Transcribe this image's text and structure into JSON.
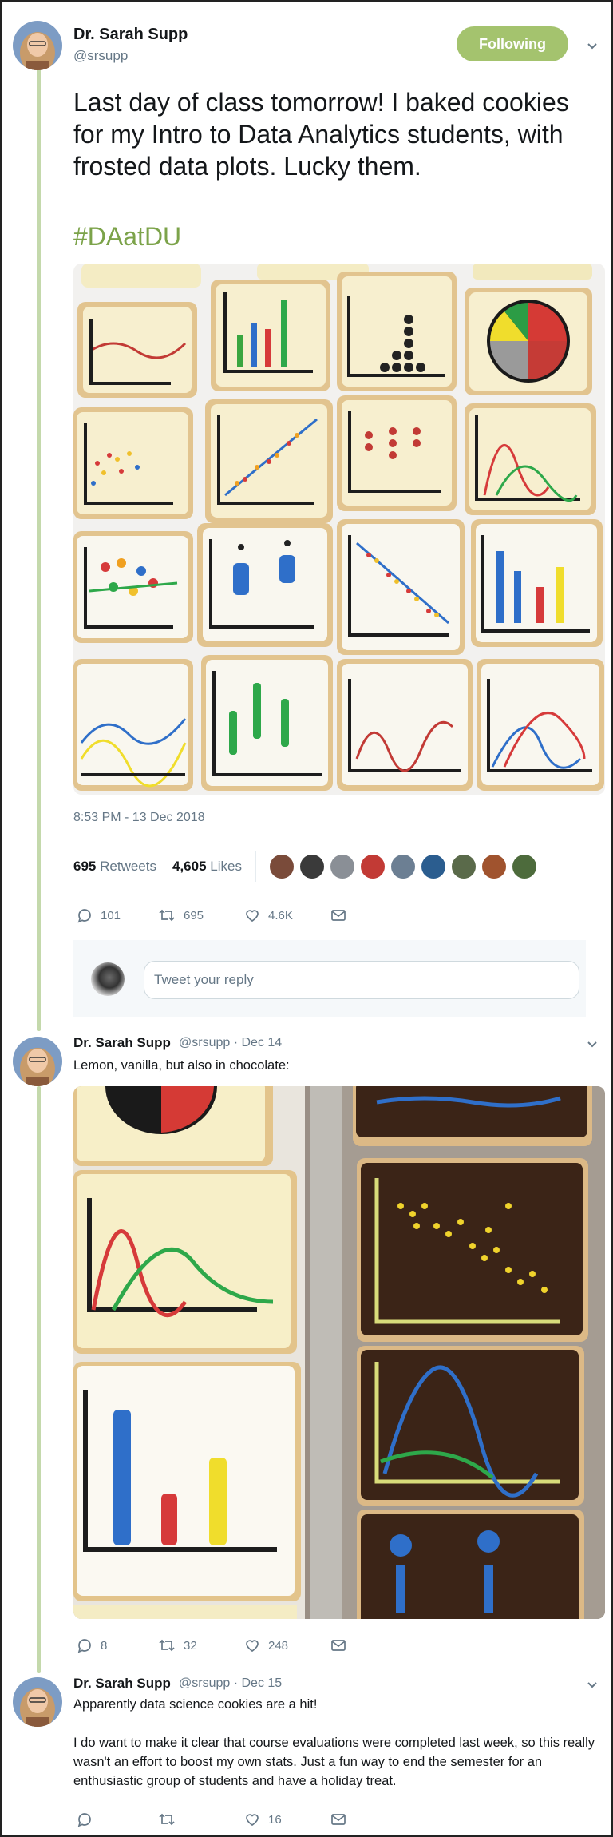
{
  "tweet": {
    "author_name": "Dr. Sarah Supp",
    "author_handle": "@srsupp",
    "follow_label": "Following",
    "text": "Last day of class tomorrow! I baked cookies for my Intro to Data Analytics students, with frosted data plots. Lucky them.",
    "hashtag": "#DAatDU",
    "timestamp": "8:53 PM - 13 Dec 2018",
    "retweets_count": "695",
    "retweets_label": "Retweets",
    "likes_count": "4,605",
    "likes_label": "Likes",
    "actions": {
      "replies": "101",
      "retweets": "695",
      "likes": "4.6K"
    },
    "reply_placeholder": "Tweet your reply"
  },
  "replies": [
    {
      "author_name": "Dr. Sarah Supp",
      "meta": "@srsupp · Dec 14",
      "text": "Lemon, vanilla, but also in chocolate:",
      "actions": {
        "replies": "8",
        "retweets": "32",
        "likes": "248"
      }
    },
    {
      "author_name": "Dr. Sarah Supp",
      "meta": "@srsupp · Dec 15",
      "text1": "Apparently data science cookies are a hit!",
      "text2": "I do want to make it clear that course evaluations were completed last week, so this really wasn't an effort to boost my own stats. Just a fun way to end the semester for an enthusiastic group of students and have a holiday treat.",
      "actions": {
        "replies": "",
        "retweets": "",
        "likes": "16"
      }
    }
  ],
  "colors": {
    "accent": "#a4c36e",
    "hashtag": "#7ca34a",
    "thread_line": "#c4d9ac",
    "muted": "#657786"
  },
  "icons": [
    "reply-icon",
    "retweet-icon",
    "like-icon",
    "message-icon",
    "chevron-down-icon"
  ]
}
